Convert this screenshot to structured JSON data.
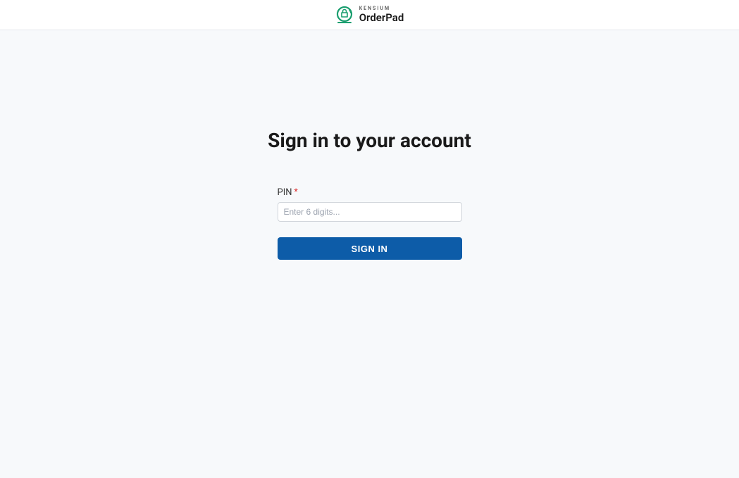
{
  "header": {
    "logo_brand": "KENSIUM",
    "logo_product": "OrderPad"
  },
  "main": {
    "title": "Sign in to your account",
    "pin_label": "PIN",
    "required_mark": "*",
    "pin_placeholder": "Enter 6 digits...",
    "signin_label": "SIGN IN"
  },
  "colors": {
    "accent_green": "#1a9e6f",
    "button_blue": "#0d5ca8",
    "required_red": "#dc2626"
  }
}
